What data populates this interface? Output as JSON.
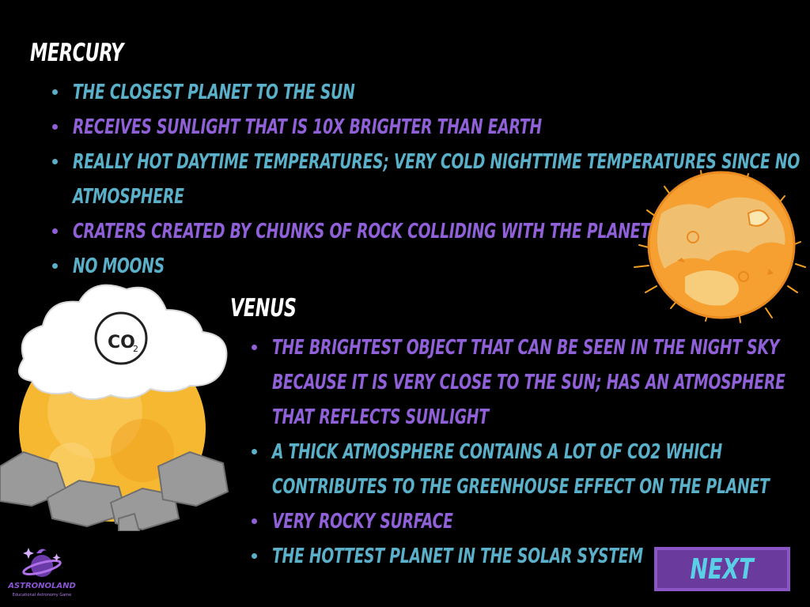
{
  "mercury": {
    "title": "Mercury",
    "facts": [
      {
        "text": "The closest planet to the sun",
        "color": "#5ab0c8"
      },
      {
        "text": "Receives sunlight that is 10x brighter than Earth",
        "color": "#9060d8"
      },
      {
        "text": "Really hot daytime temperatures; very cold nighttime temperatures since no",
        "text2": "atmosphere",
        "color": "#5ab0c8"
      },
      {
        "text": "Craters created by chunks of rock colliding with the planet",
        "color": "#9060d8"
      },
      {
        "text": "No moons",
        "color": "#5ab0c8"
      }
    ]
  },
  "venus": {
    "title": "Venus",
    "facts": [
      {
        "text": "The brightest object that can be seen in the night sky",
        "text2": "because it is very close to the sun; has an atmosphere",
        "text3": "that reflects sunlight",
        "color": "#9060d8"
      },
      {
        "text": "A thick atmosphere contains a lot of CO2 which",
        "text2": "contributes to the greenhouse effect on the planet",
        "color": "#5ab0c8"
      },
      {
        "text": "Very rocky surface",
        "color": "#9060d8"
      },
      {
        "text": "The hottest planet in the solar system",
        "color": "#5ab0c8"
      }
    ]
  },
  "cloud": {
    "label": "CO",
    "sub": "2"
  },
  "next_label": "Next",
  "logo": {
    "name": "ASTRONOLAND",
    "tagline": "Educational Astronomy Game"
  },
  "icons": {
    "mercury": "mercury-planet-icon",
    "venus": "venus-planet-icon",
    "cloud": "co2-cloud-icon",
    "logo": "astronoland-logo-icon"
  },
  "colors": {
    "background": "#000000",
    "teal": "#5ab0c8",
    "purple": "#9060d8",
    "button": "#6a3a9c",
    "button_text": "#5ad0e6"
  }
}
